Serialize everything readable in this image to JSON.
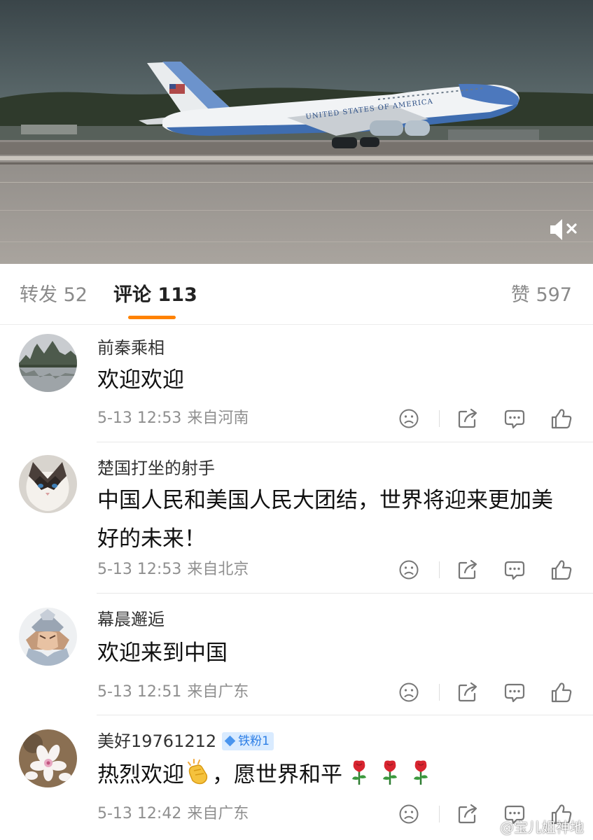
{
  "video": {
    "aircraft_lettering": "UNITED STATES OF AMERICA",
    "mute_icon": "speaker-muted-icon",
    "colors": {
      "sky": "#3f4a4e",
      "runway": "#9d9893",
      "fuselage_blue": "#5f86c2"
    }
  },
  "tabs": {
    "repost": {
      "label": "转发",
      "count": "52"
    },
    "comments": {
      "label": "评论",
      "count": "113",
      "active": true
    },
    "likes": {
      "label": "赞",
      "count": "597"
    },
    "accent_color": "#ff8200"
  },
  "comments": [
    {
      "username": "前秦乘相",
      "text": "欢迎欢迎",
      "time": "5-13 12:53",
      "location": "来自河南",
      "avatar": "landscape-photo"
    },
    {
      "username": "楚国打坐的射手",
      "text": "中国人民和美国人民大团结，世界将迎来更加美好的未来！",
      "time": "5-13 12:53",
      "location": "来自北京",
      "avatar": "ragdoll-cat-photo"
    },
    {
      "username": "幕晨邂逅",
      "text": "欢迎来到中国",
      "time": "5-13 12:51",
      "location": "来自广东",
      "avatar": "anime-character"
    },
    {
      "username": "美好19761212",
      "badge": "铁粉1",
      "text_part1": "热烈欢迎",
      "text_part2": "，愿世界和平",
      "emojis": [
        "clapping-hands-icon",
        "rose-icon",
        "rose-icon",
        "rose-icon"
      ],
      "time": "5-13 12:42",
      "location": "来自广东",
      "avatar": "flowers-photo"
    }
  ],
  "action_icons": [
    "dislike-face-icon",
    "share-icon",
    "reply-icon",
    "like-icon"
  ],
  "watermark": {
    "text": "@宝儿姐神地",
    "icon": "weibo-logo-icon"
  }
}
